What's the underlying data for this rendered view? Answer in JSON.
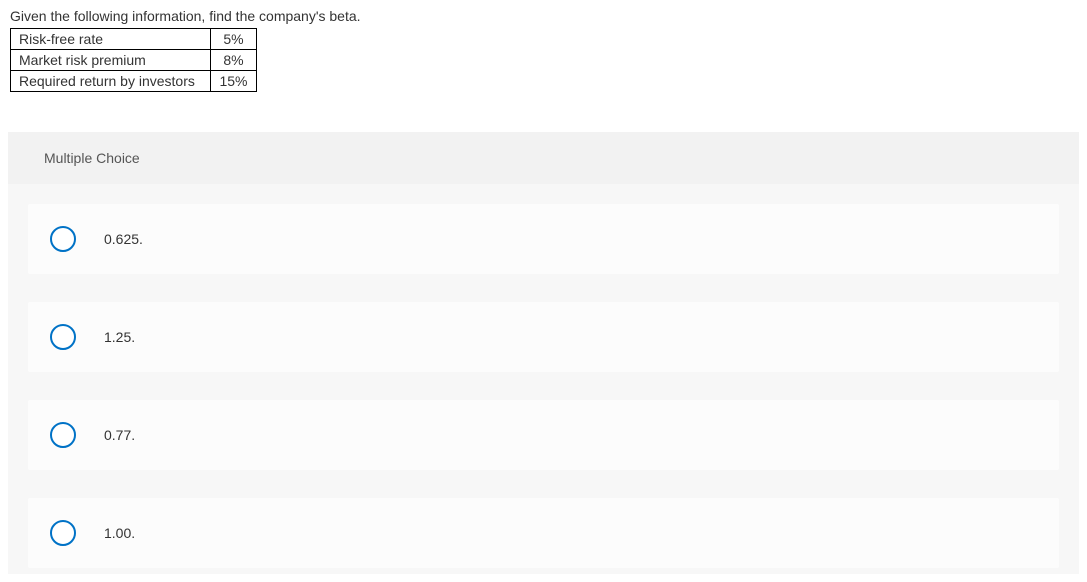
{
  "question": {
    "prompt": "Given the following information, find the company's beta.",
    "table": {
      "rows": [
        {
          "label": "Risk-free rate",
          "value": "5%"
        },
        {
          "label": "Market risk premium",
          "value": "8%"
        },
        {
          "label": "Required return by investors",
          "value": "15%"
        }
      ]
    }
  },
  "quiz": {
    "type_label": "Multiple Choice",
    "options": [
      {
        "text": "0.625."
      },
      {
        "text": "1.25."
      },
      {
        "text": "0.77."
      },
      {
        "text": "1.00."
      }
    ]
  }
}
